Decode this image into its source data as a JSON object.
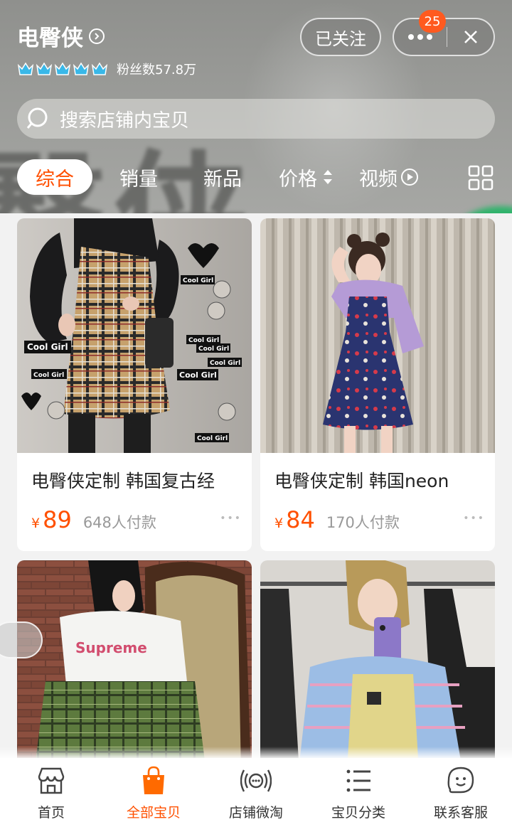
{
  "header": {
    "shop_name": "电臀侠",
    "fans_label": "粉丝数57.8万",
    "crown_count": 5,
    "follow_label": "已关注",
    "notification_count": "25"
  },
  "search": {
    "placeholder": "搜索店铺内宝贝"
  },
  "sort_tabs": [
    {
      "label": "综合",
      "active": true
    },
    {
      "label": "销量",
      "active": false
    },
    {
      "label": "新品",
      "active": false
    },
    {
      "label": "价格",
      "active": false
    },
    {
      "label": "视频",
      "active": false
    }
  ],
  "products": [
    {
      "title": "电臀侠定制 韩国复古经",
      "currency": "¥",
      "price": "89",
      "sold": "648人付款",
      "photo_text": [
        "Cool Girl",
        "Cool Girl",
        "Cool Girl",
        "Cool Girl",
        "Cool Girl",
        "Cool Girl",
        "Cool Girl",
        "Cool Girl"
      ]
    },
    {
      "title": "电臀侠定制 韩国neon",
      "currency": "¥",
      "price": "84",
      "sold": "170人付款"
    },
    {
      "title": "",
      "price": "",
      "sold": "",
      "photo_text": [
        "Supreme"
      ]
    },
    {
      "title": "",
      "price": "",
      "sold": ""
    }
  ],
  "bottom_nav": [
    {
      "label": "首页",
      "icon": "shop-icon",
      "active": false
    },
    {
      "label": "全部宝贝",
      "icon": "shopping-bag-icon",
      "active": true
    },
    {
      "label": "店铺微淘",
      "icon": "broadcast-icon",
      "active": false
    },
    {
      "label": "宝贝分类",
      "icon": "category-list-icon",
      "active": false
    },
    {
      "label": "联系客服",
      "icon": "chat-icon",
      "active": false
    }
  ],
  "colors": {
    "accent": "#ff5000",
    "header_bg": "#9a9b98",
    "badge": "#ff5a1f"
  }
}
